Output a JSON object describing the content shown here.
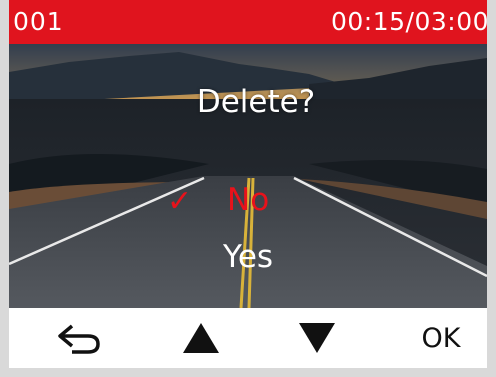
{
  "status_bar": {
    "clip_number": "001",
    "timecode": "00:15/03:00",
    "background": "#e0141e"
  },
  "dialog": {
    "prompt": "Delete?",
    "selected_mark": "✓",
    "options": [
      {
        "label": "No",
        "selected": true,
        "color": "#e8121b"
      },
      {
        "label": "Yes",
        "selected": false,
        "color": "#ffffff"
      }
    ]
  },
  "controls": {
    "back_icon": "return-arrow-icon",
    "up_icon": "triangle-up-icon",
    "down_icon": "triangle-down-icon",
    "ok_label": "OK"
  }
}
